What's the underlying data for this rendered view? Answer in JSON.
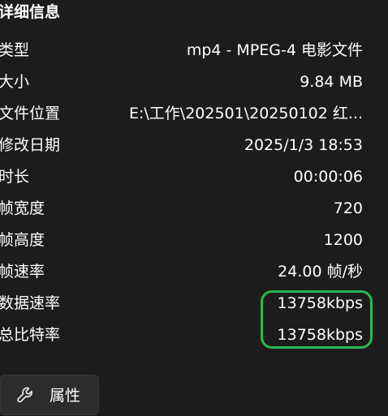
{
  "details": {
    "title": "详细信息",
    "rows": [
      {
        "label": "类型",
        "value": "mp4 - MPEG-4 电影文件"
      },
      {
        "label": "大小",
        "value": "9.84 MB"
      },
      {
        "label": "文件位置",
        "value": "E:\\工作\\202501\\20250102 红..."
      },
      {
        "label": "修改日期",
        "value": "2025/1/3 18:53"
      },
      {
        "label": "时长",
        "value": "00:00:06"
      },
      {
        "label": "帧宽度",
        "value": "720"
      },
      {
        "label": "帧高度",
        "value": "1200"
      },
      {
        "label": "帧速率",
        "value": "24.00 帧/秒"
      },
      {
        "label": "数据速率",
        "value": "13758kbps"
      },
      {
        "label": "总比特率",
        "value": "13758kbps"
      }
    ]
  },
  "properties_button": {
    "label": "属性",
    "icon": "wrench-icon"
  },
  "colors": {
    "background": "#1c1c1c",
    "highlight": "#2db84d",
    "button_bg": "#2c2c2c"
  }
}
